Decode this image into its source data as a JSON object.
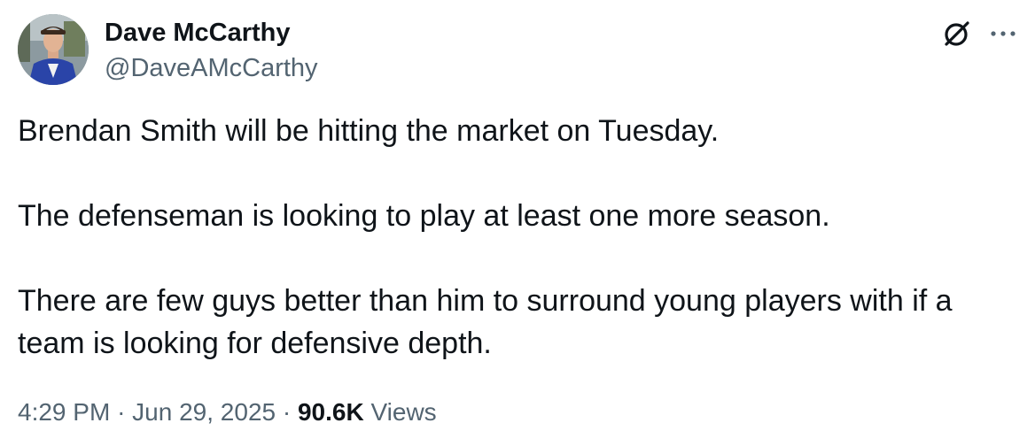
{
  "author": {
    "display_name": "Dave McCarthy",
    "handle": "@DaveAMcCarthy"
  },
  "tweet": {
    "paragraphs": [
      "Brendan Smith will be hitting the market on Tuesday.",
      "The defenseman is looking to play at least one more season.",
      "There are few guys better than him to surround young players with if a team is looking for defensive depth."
    ]
  },
  "meta": {
    "time": "4:29 PM",
    "separator": "·",
    "date": "Jun 29, 2025",
    "views_count": "90.6K",
    "views_label": "Views"
  },
  "icons": {
    "top_right": [
      "grok-icon",
      "more-icon"
    ]
  },
  "colors": {
    "text_primary": "#0f1419",
    "text_secondary": "#536471"
  }
}
